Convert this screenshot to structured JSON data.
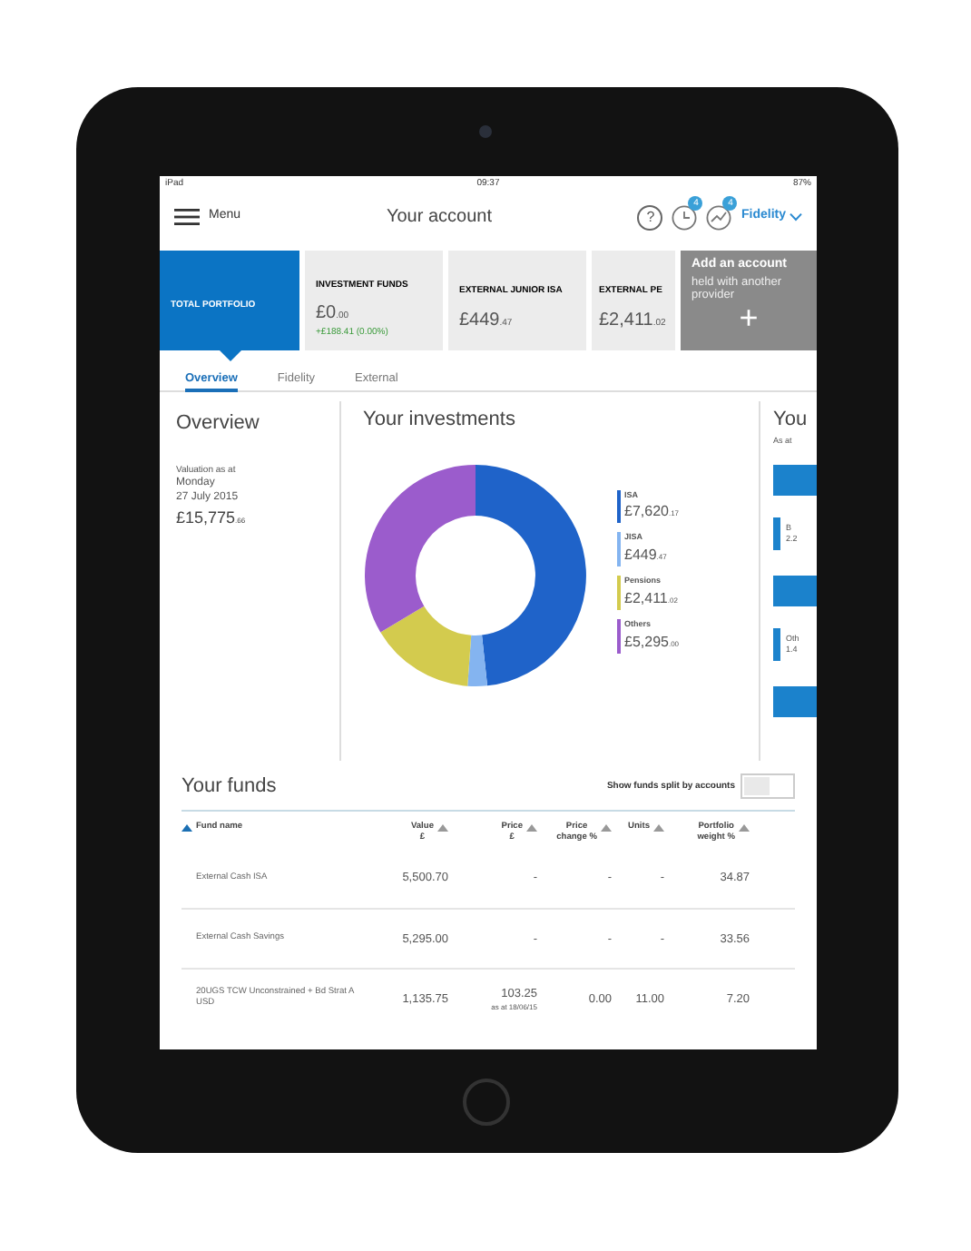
{
  "status_bar": {
    "carrier": "iPad",
    "time": "09:37",
    "battery": "87%"
  },
  "header": {
    "menu_label": "Menu",
    "title": "Your account",
    "help_label": "?",
    "badges": [
      "4",
      "4"
    ],
    "provider": "Fidelity"
  },
  "accounts": [
    {
      "label": "TOTAL PORTFOLIO",
      "selected": true
    },
    {
      "label": "INVESTMENT FUNDS",
      "amount": "£0",
      "pence": ".00",
      "change": "+£188.41 (0.00%)",
      "selected": false
    },
    {
      "label": "EXTERNAL JUNIOR ISA",
      "amount": "£449",
      "pence": ".47",
      "selected": false
    },
    {
      "label": "EXTERNAL PE",
      "amount": "£2,411",
      "pence": ".02",
      "selected": false
    }
  ],
  "add_account": {
    "title": "Add an account",
    "text": "held with another provider",
    "plus": "+"
  },
  "tabs": [
    {
      "label": "Overview",
      "selected": true
    },
    {
      "label": "Fidelity",
      "selected": false
    },
    {
      "label": "External",
      "selected": false
    }
  ],
  "overview": {
    "title": "Overview",
    "caption": "Valuation as at",
    "day": "Monday",
    "date": "27 July 2015",
    "amount": "£15,775",
    "pence": ".66"
  },
  "investments": {
    "title": "Your investments",
    "legend": [
      {
        "label": "ISA",
        "amount": "£7,620",
        "pence": ".17",
        "color": "#1f63c9"
      },
      {
        "label": "JISA",
        "amount": "£449",
        "pence": ".47",
        "color": "#84b4f0"
      },
      {
        "label": "Pensions",
        "amount": "£2,411",
        "pence": ".02",
        "color": "#d3cb4e"
      },
      {
        "label": "Others",
        "amount": "£5,295",
        "pence": ".00",
        "color": "#9b5ccc"
      }
    ],
    "chart_data": {
      "type": "donut",
      "values": [
        48.3,
        2.85,
        15.28,
        33.57
      ]
    }
  },
  "third_panel": {
    "title": "You",
    "caption": "As at",
    "rows": [
      {
        "label": "B",
        "value": "2.2"
      },
      {
        "label": "Oth",
        "value": "1.4"
      }
    ]
  },
  "funds": {
    "title": "Your funds",
    "toggle_label": "Show funds split by accounts",
    "toggle_on": false,
    "columns": [
      {
        "label": "Fund name",
        "sorted": true
      },
      {
        "label": "Value",
        "sub": "£",
        "sorted": false
      },
      {
        "label": "Price",
        "sub": "£",
        "sorted": false
      },
      {
        "label": "Price",
        "sub": "change %",
        "sorted": false
      },
      {
        "label": "Units",
        "sorted": false
      },
      {
        "label": "Portfolio",
        "sub": "weight %",
        "sorted": false
      }
    ],
    "rows": [
      {
        "cells": [
          "External Cash ISA",
          "5,500.70",
          "-",
          "-",
          "-",
          "34.87"
        ]
      },
      {
        "cells": [
          "External Cash Savings",
          "5,295.00",
          "-",
          "-",
          "-",
          "33.56"
        ]
      },
      {
        "cells": [
          "20UGS TCW Unconstrained + Bd Strat A USD",
          "1,135.75",
          "103.25",
          "0.00",
          "11.00",
          "7.20"
        ],
        "price_note": "as at 18/06/15"
      }
    ]
  }
}
